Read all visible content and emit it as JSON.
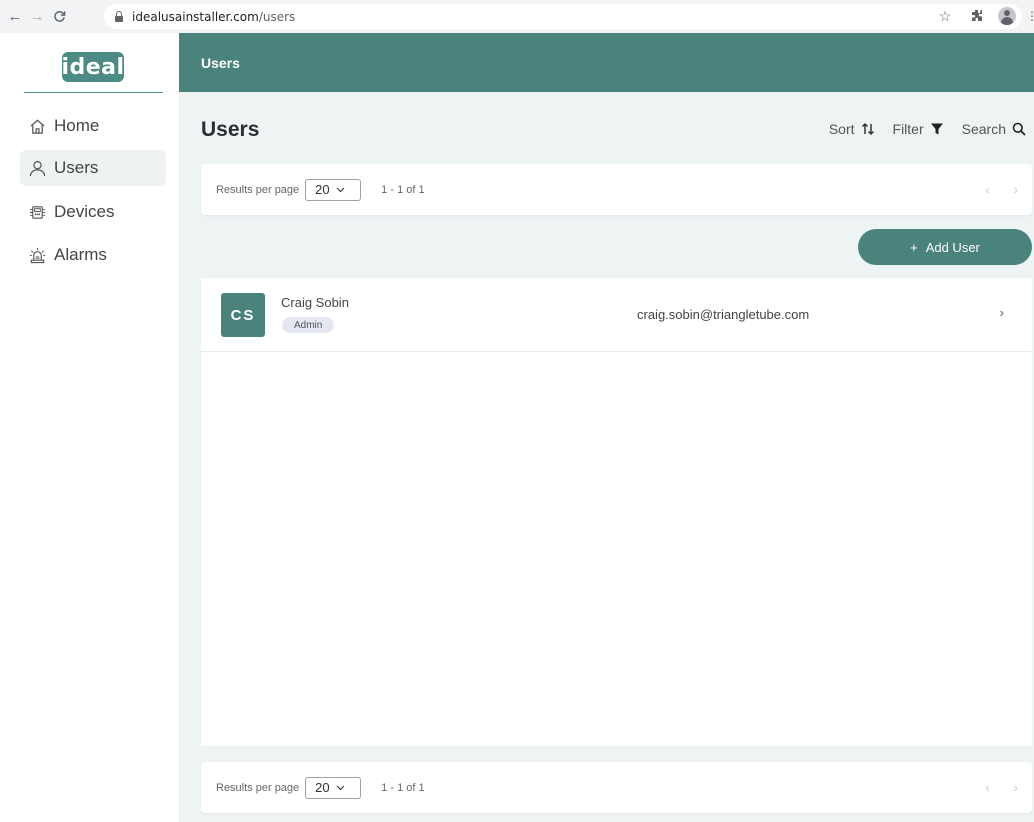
{
  "browser": {
    "url_host": "idealusainstaller.com",
    "url_path": "/users"
  },
  "sidebar": {
    "logo_text": "ideal",
    "items": [
      {
        "label": "Home",
        "icon": "home-icon",
        "active": false
      },
      {
        "label": "Users",
        "icon": "user-icon",
        "active": true
      },
      {
        "label": "Devices",
        "icon": "device-icon",
        "active": false
      },
      {
        "label": "Alarms",
        "icon": "alarm-icon",
        "active": false
      }
    ]
  },
  "header": {
    "title": "Users"
  },
  "page": {
    "title": "Users",
    "sort_label": "Sort",
    "filter_label": "Filter",
    "search_label": "Search",
    "add_user_label": "Add User"
  },
  "pager_top": {
    "results_label": "Results per page",
    "per_page": "20",
    "range": "1 - 1 of 1"
  },
  "pager_bottom": {
    "results_label": "Results per page",
    "per_page": "20",
    "range": "1 - 1 of 1"
  },
  "users": [
    {
      "initials": "CS",
      "name": "Craig Sobin",
      "role": "Admin",
      "email": "craig.sobin@triangletube.com"
    }
  ],
  "colors": {
    "brand": "#4a837c",
    "background": "#eef3f4"
  }
}
